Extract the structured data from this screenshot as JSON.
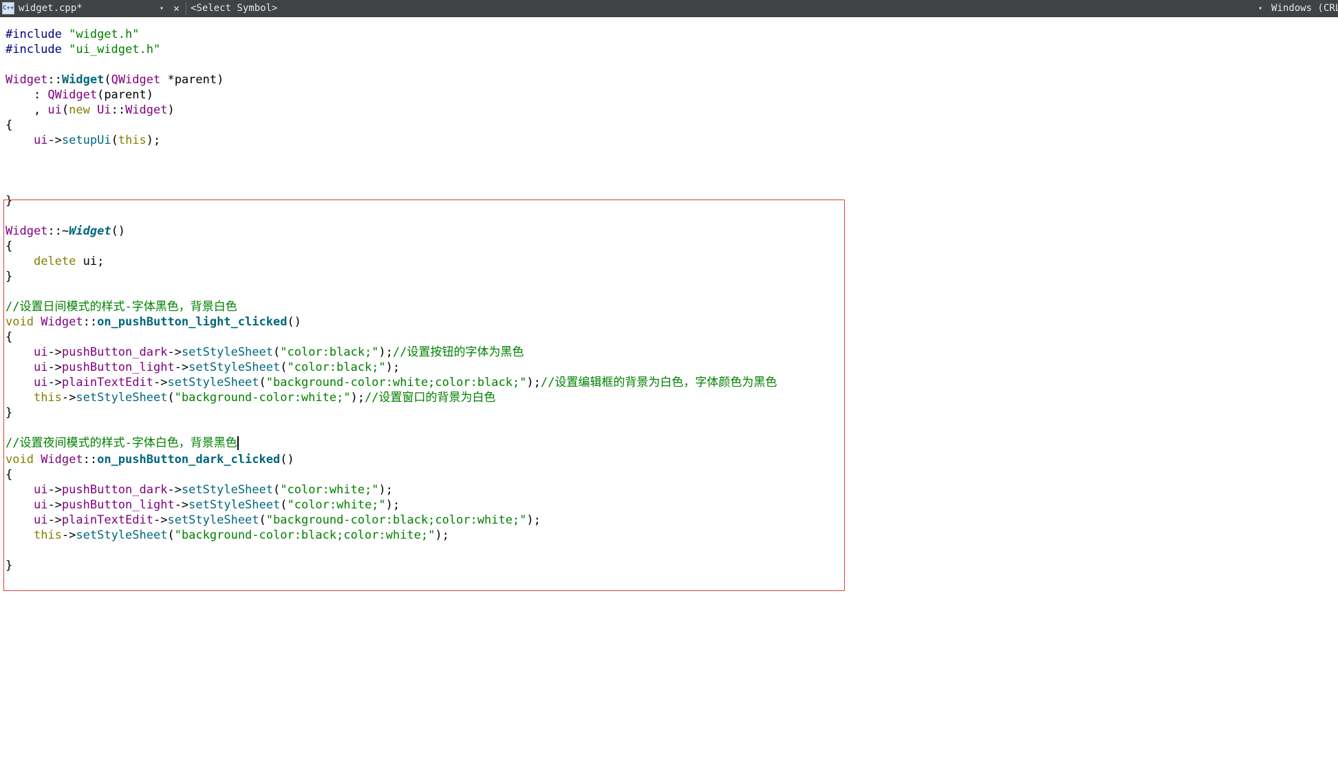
{
  "toolbar": {
    "file_icon_text": "C++",
    "file_name": "widget.cpp*",
    "file_dropdown": "▾",
    "close_glyph": "✕",
    "symbol_selector": "<Select Symbol>",
    "line_ending_dropdown": "▾",
    "line_ending": "Windows (CRLF)"
  },
  "code": {
    "l1": [
      {
        "c": "pp",
        "t": "#include "
      },
      {
        "c": "str",
        "t": "\"widget.h\""
      }
    ],
    "l2": [
      {
        "c": "pp",
        "t": "#include "
      },
      {
        "c": "str",
        "t": "\"ui_widget.h\""
      }
    ],
    "l3": [],
    "l4": [
      {
        "c": "cls",
        "t": "Widget"
      },
      {
        "c": "pl",
        "t": "::"
      },
      {
        "c": "fnb",
        "t": "Widget"
      },
      {
        "c": "pl",
        "t": "("
      },
      {
        "c": "cls",
        "t": "QWidget"
      },
      {
        "c": "pl",
        "t": " *parent)"
      }
    ],
    "l5": [
      {
        "c": "pl",
        "t": "    : "
      },
      {
        "c": "cls",
        "t": "QWidget"
      },
      {
        "c": "pl",
        "t": "(parent)"
      }
    ],
    "l6": [
      {
        "c": "pl",
        "t": "    , "
      },
      {
        "c": "cls",
        "t": "ui"
      },
      {
        "c": "pl",
        "t": "("
      },
      {
        "c": "kw",
        "t": "new "
      },
      {
        "c": "cls",
        "t": "Ui"
      },
      {
        "c": "pl",
        "t": "::"
      },
      {
        "c": "cls",
        "t": "Widget"
      },
      {
        "c": "pl",
        "t": ")"
      }
    ],
    "l7": [
      {
        "c": "pl",
        "t": "{"
      }
    ],
    "l8": [
      {
        "c": "pl",
        "t": "    "
      },
      {
        "c": "cls",
        "t": "ui"
      },
      {
        "c": "pl",
        "t": "->"
      },
      {
        "c": "fn",
        "t": "setupUi"
      },
      {
        "c": "pl",
        "t": "("
      },
      {
        "c": "kw",
        "t": "this"
      },
      {
        "c": "pl",
        "t": ");"
      }
    ],
    "l9": [],
    "l10": [],
    "l11": [],
    "l12": [
      {
        "c": "pl",
        "t": "}"
      }
    ],
    "l13": [],
    "l14": [
      {
        "c": "cls",
        "t": "Widget"
      },
      {
        "c": "pl",
        "t": "::~"
      },
      {
        "c": "fni",
        "t": "Widget"
      },
      {
        "c": "pl",
        "t": "()"
      }
    ],
    "l15": [
      {
        "c": "pl",
        "t": "{"
      }
    ],
    "l16": [
      {
        "c": "pl",
        "t": "    "
      },
      {
        "c": "kw",
        "t": "delete"
      },
      {
        "c": "pl",
        "t": " ui;"
      }
    ],
    "l17": [
      {
        "c": "pl",
        "t": "}"
      }
    ],
    "l18": [],
    "l19": [
      {
        "c": "cm",
        "t": "//设置日间模式的样式-字体黑色，背景白色"
      }
    ],
    "l20": [
      {
        "c": "kw",
        "t": "void "
      },
      {
        "c": "cls",
        "t": "Widget"
      },
      {
        "c": "pl",
        "t": "::"
      },
      {
        "c": "fnb",
        "t": "on_pushButton_light_clicked"
      },
      {
        "c": "pl",
        "t": "()"
      }
    ],
    "l21": [
      {
        "c": "pl",
        "t": "{"
      }
    ],
    "l22": [
      {
        "c": "pl",
        "t": "    "
      },
      {
        "c": "cls",
        "t": "ui"
      },
      {
        "c": "pl",
        "t": "->"
      },
      {
        "c": "cls",
        "t": "pushButton_dark"
      },
      {
        "c": "pl",
        "t": "->"
      },
      {
        "c": "fn",
        "t": "setStyleSheet"
      },
      {
        "c": "pl",
        "t": "("
      },
      {
        "c": "str",
        "t": "\"color:black;\""
      },
      {
        "c": "pl",
        "t": ");"
      },
      {
        "c": "cm",
        "t": "//设置按钮的字体为黑色"
      }
    ],
    "l23": [
      {
        "c": "pl",
        "t": "    "
      },
      {
        "c": "cls",
        "t": "ui"
      },
      {
        "c": "pl",
        "t": "->"
      },
      {
        "c": "cls",
        "t": "pushButton_light"
      },
      {
        "c": "pl",
        "t": "->"
      },
      {
        "c": "fn",
        "t": "setStyleSheet"
      },
      {
        "c": "pl",
        "t": "("
      },
      {
        "c": "str",
        "t": "\"color:black;\""
      },
      {
        "c": "pl",
        "t": ");"
      }
    ],
    "l24": [
      {
        "c": "pl",
        "t": "    "
      },
      {
        "c": "cls",
        "t": "ui"
      },
      {
        "c": "pl",
        "t": "->"
      },
      {
        "c": "cls",
        "t": "plainTextEdit"
      },
      {
        "c": "pl",
        "t": "->"
      },
      {
        "c": "fn",
        "t": "setStyleSheet"
      },
      {
        "c": "pl",
        "t": "("
      },
      {
        "c": "str",
        "t": "\"background-color:white;color:black;\""
      },
      {
        "c": "pl",
        "t": ");"
      },
      {
        "c": "cm",
        "t": "//设置编辑框的背景为白色，字体颜色为黑色"
      }
    ],
    "l25": [
      {
        "c": "pl",
        "t": "    "
      },
      {
        "c": "kw",
        "t": "this"
      },
      {
        "c": "pl",
        "t": "->"
      },
      {
        "c": "fn",
        "t": "setStyleSheet"
      },
      {
        "c": "pl",
        "t": "("
      },
      {
        "c": "str",
        "t": "\"background-color:white;\""
      },
      {
        "c": "pl",
        "t": ");"
      },
      {
        "c": "cm",
        "t": "//设置窗口的背景为白色"
      }
    ],
    "l26": [
      {
        "c": "pl",
        "t": "}"
      }
    ],
    "l27": [],
    "l28": [
      {
        "c": "cm",
        "t": "//设置夜间模式的样式-字体白色，背景黑色"
      }
    ],
    "l29": [
      {
        "c": "kw",
        "t": "void "
      },
      {
        "c": "cls",
        "t": "Widget"
      },
      {
        "c": "pl",
        "t": "::"
      },
      {
        "c": "fnb",
        "t": "on_pushButton_dark_clicked"
      },
      {
        "c": "pl",
        "t": "()"
      }
    ],
    "l30": [
      {
        "c": "pl",
        "t": "{"
      }
    ],
    "l31": [
      {
        "c": "pl",
        "t": "    "
      },
      {
        "c": "cls",
        "t": "ui"
      },
      {
        "c": "pl",
        "t": "->"
      },
      {
        "c": "cls",
        "t": "pushButton_dark"
      },
      {
        "c": "pl",
        "t": "->"
      },
      {
        "c": "fn",
        "t": "setStyleSheet"
      },
      {
        "c": "pl",
        "t": "("
      },
      {
        "c": "str",
        "t": "\"color:white;\""
      },
      {
        "c": "pl",
        "t": ");"
      }
    ],
    "l32": [
      {
        "c": "pl",
        "t": "    "
      },
      {
        "c": "cls",
        "t": "ui"
      },
      {
        "c": "pl",
        "t": "->"
      },
      {
        "c": "cls",
        "t": "pushButton_light"
      },
      {
        "c": "pl",
        "t": "->"
      },
      {
        "c": "fn",
        "t": "setStyleSheet"
      },
      {
        "c": "pl",
        "t": "("
      },
      {
        "c": "str",
        "t": "\"color:white;\""
      },
      {
        "c": "pl",
        "t": ");"
      }
    ],
    "l33": [
      {
        "c": "pl",
        "t": "    "
      },
      {
        "c": "cls",
        "t": "ui"
      },
      {
        "c": "pl",
        "t": "->"
      },
      {
        "c": "cls",
        "t": "plainTextEdit"
      },
      {
        "c": "pl",
        "t": "->"
      },
      {
        "c": "fn",
        "t": "setStyleSheet"
      },
      {
        "c": "pl",
        "t": "("
      },
      {
        "c": "str",
        "t": "\"background-color:black;color:white;\""
      },
      {
        "c": "pl",
        "t": ");"
      }
    ],
    "l34": [
      {
        "c": "pl",
        "t": "    "
      },
      {
        "c": "kw",
        "t": "this"
      },
      {
        "c": "pl",
        "t": "->"
      },
      {
        "c": "fn",
        "t": "setStyleSheet"
      },
      {
        "c": "pl",
        "t": "("
      },
      {
        "c": "str",
        "t": "\"background-color:black;color:white;\""
      },
      {
        "c": "pl",
        "t": ");"
      }
    ],
    "l35": [],
    "l36": [
      {
        "c": "pl",
        "t": "}"
      }
    ]
  },
  "colors": {
    "toolbar_bg": "#404244",
    "preprocessor": "#000080",
    "string": "#008000",
    "type": "#800080",
    "function": "#00677c",
    "keyword": "#808000",
    "comment": "#008000",
    "highlight_box": "#e03c3c"
  }
}
